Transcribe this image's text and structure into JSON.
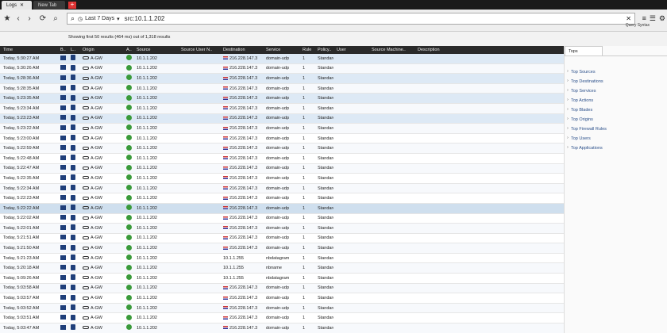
{
  "tabs": [
    {
      "label": "Logs",
      "active": true
    },
    {
      "label": "New Tab",
      "active": false
    }
  ],
  "toolbar": {
    "time_period": "Last 7 Days",
    "query": "src:10.1.1.202",
    "query_syntax": "Query Syntax",
    "results_info": "Showing first 50 results (464 ms) out of 1,318 results"
  },
  "columns": [
    "Time",
    "B..",
    "L..",
    "Origin",
    "A..",
    "Source",
    "Source User N..",
    "Destination",
    "Service",
    "Rule",
    "Policy..",
    "User",
    "Source Machine..",
    "Description"
  ],
  "rows": [
    {
      "time": "Today, 5:30:27 AM",
      "origin": "A-GW",
      "source": "10.1.1.202",
      "destination": "216.228.147.3",
      "service": "domain-udp",
      "rule": "1",
      "policy": "Standard",
      "flag": true
    },
    {
      "time": "Today, 5:30:26 AM",
      "origin": "A-GW",
      "source": "10.1.1.202",
      "destination": "216.228.147.3",
      "service": "domain-udp",
      "rule": "1",
      "policy": "Standard",
      "flag": true
    },
    {
      "time": "Today, 5:28:36 AM",
      "origin": "A-GW",
      "source": "10.1.1.202",
      "destination": "216.228.147.3",
      "service": "domain-udp",
      "rule": "1",
      "policy": "Standard",
      "flag": true
    },
    {
      "time": "Today, 5:28:35 AM",
      "origin": "A-GW",
      "source": "10.1.1.202",
      "destination": "216.228.147.3",
      "service": "domain-udp",
      "rule": "1",
      "policy": "Standard",
      "flag": true
    },
    {
      "time": "Today, 5:23:35 AM",
      "origin": "A-GW",
      "source": "10.1.1.202",
      "destination": "216.228.147.3",
      "service": "domain-udp",
      "rule": "1",
      "policy": "Standard",
      "flag": true
    },
    {
      "time": "Today, 5:23:34 AM",
      "origin": "A-GW",
      "source": "10.1.1.202",
      "destination": "216.228.147.3",
      "service": "domain-udp",
      "rule": "1",
      "policy": "Standard",
      "flag": true
    },
    {
      "time": "Today, 5:23:23 AM",
      "origin": "A-GW",
      "source": "10.1.1.202",
      "destination": "216.228.147.3",
      "service": "domain-udp",
      "rule": "1",
      "policy": "Standard",
      "flag": true
    },
    {
      "time": "Today, 5:23:22 AM",
      "origin": "A-GW",
      "source": "10.1.1.202",
      "destination": "216.228.147.3",
      "service": "domain-udp",
      "rule": "1",
      "policy": "Standard",
      "flag": true
    },
    {
      "time": "Today, 5:23:00 AM",
      "origin": "A-GW",
      "source": "10.1.1.202",
      "destination": "216.228.147.3",
      "service": "domain-udp",
      "rule": "1",
      "policy": "Standard",
      "flag": true
    },
    {
      "time": "Today, 5:22:59 AM",
      "origin": "A-GW",
      "source": "10.1.1.202",
      "destination": "216.228.147.3",
      "service": "domain-udp",
      "rule": "1",
      "policy": "Standard",
      "flag": true
    },
    {
      "time": "Today, 5:22:48 AM",
      "origin": "A-GW",
      "source": "10.1.1.202",
      "destination": "216.228.147.3",
      "service": "domain-udp",
      "rule": "1",
      "policy": "Standard",
      "flag": true
    },
    {
      "time": "Today, 5:22:47 AM",
      "origin": "A-GW",
      "source": "10.1.1.202",
      "destination": "216.228.147.3",
      "service": "domain-udp",
      "rule": "1",
      "policy": "Standard",
      "flag": true
    },
    {
      "time": "Today, 5:22:35 AM",
      "origin": "A-GW",
      "source": "10.1.1.202",
      "destination": "216.228.147.3",
      "service": "domain-udp",
      "rule": "1",
      "policy": "Standard",
      "flag": true
    },
    {
      "time": "Today, 5:22:34 AM",
      "origin": "A-GW",
      "source": "10.1.1.202",
      "destination": "216.228.147.3",
      "service": "domain-udp",
      "rule": "1",
      "policy": "Standard",
      "flag": true
    },
    {
      "time": "Today, 5:22:23 AM",
      "origin": "A-GW",
      "source": "10.1.1.202",
      "destination": "216.228.147.3",
      "service": "domain-udp",
      "rule": "1",
      "policy": "Standard",
      "flag": true
    },
    {
      "time": "Today, 5:22:22 AM",
      "origin": "A-GW",
      "source": "10.1.1.202",
      "destination": "216.228.147.3",
      "service": "domain-udp",
      "rule": "1",
      "policy": "Standard",
      "flag": true
    },
    {
      "time": "Today, 5:22:02 AM",
      "origin": "A-GW",
      "source": "10.1.1.202",
      "destination": "216.228.147.3",
      "service": "domain-udp",
      "rule": "1",
      "policy": "Standard",
      "flag": true
    },
    {
      "time": "Today, 5:22:01 AM",
      "origin": "A-GW",
      "source": "10.1.1.202",
      "destination": "216.228.147.3",
      "service": "domain-udp",
      "rule": "1",
      "policy": "Standard",
      "flag": true
    },
    {
      "time": "Today, 5:21:51 AM",
      "origin": "A-GW",
      "source": "10.1.1.202",
      "destination": "216.228.147.3",
      "service": "domain-udp",
      "rule": "1",
      "policy": "Standard",
      "flag": true
    },
    {
      "time": "Today, 5:21:50 AM",
      "origin": "A-GW",
      "source": "10.1.1.202",
      "destination": "216.228.147.3",
      "service": "domain-udp",
      "rule": "1",
      "policy": "Standard",
      "flag": true
    },
    {
      "time": "Today, 5:21:23 AM",
      "origin": "A-GW",
      "source": "10.1.1.202",
      "destination": "10.1.1.255",
      "service": "nbdatagram",
      "rule": "1",
      "policy": "Standard",
      "flag": false
    },
    {
      "time": "Today, 5:20:18 AM",
      "origin": "A-GW",
      "source": "10.1.1.202",
      "destination": "10.1.1.255",
      "service": "nbname",
      "rule": "1",
      "policy": "Standard",
      "flag": false
    },
    {
      "time": "Today, 5:09:26 AM",
      "origin": "A-GW",
      "source": "10.1.1.202",
      "destination": "10.1.1.255",
      "service": "nbdatagram",
      "rule": "1",
      "policy": "Standard",
      "flag": false
    },
    {
      "time": "Today, 5:03:58 AM",
      "origin": "A-GW",
      "source": "10.1.1.202",
      "destination": "216.228.147.3",
      "service": "domain-udp",
      "rule": "1",
      "policy": "Standard",
      "flag": true
    },
    {
      "time": "Today, 5:03:57 AM",
      "origin": "A-GW",
      "source": "10.1.1.202",
      "destination": "216.228.147.3",
      "service": "domain-udp",
      "rule": "1",
      "policy": "Standard",
      "flag": true
    },
    {
      "time": "Today, 5:03:52 AM",
      "origin": "A-GW",
      "source": "10.1.1.202",
      "destination": "216.228.147.3",
      "service": "domain-udp",
      "rule": "1",
      "policy": "Standard",
      "flag": true
    },
    {
      "time": "Today, 5:03:51 AM",
      "origin": "A-GW",
      "source": "10.1.1.202",
      "destination": "216.228.147.3",
      "service": "domain-udp",
      "rule": "1",
      "policy": "Standard",
      "flag": true
    },
    {
      "time": "Today, 5:03:47 AM",
      "origin": "A-GW",
      "source": "10.1.1.202",
      "destination": "216.228.147.3",
      "service": "domain-udp",
      "rule": "1",
      "policy": "Standard",
      "flag": true
    }
  ],
  "side": {
    "tab_label": "Tops",
    "items": [
      "Top Sources",
      "Top Destinations",
      "Top Services",
      "Top Actions",
      "Top Blades",
      "Top Origins",
      "Top Firewall Rules",
      "Top Users",
      "Top Applications"
    ]
  }
}
